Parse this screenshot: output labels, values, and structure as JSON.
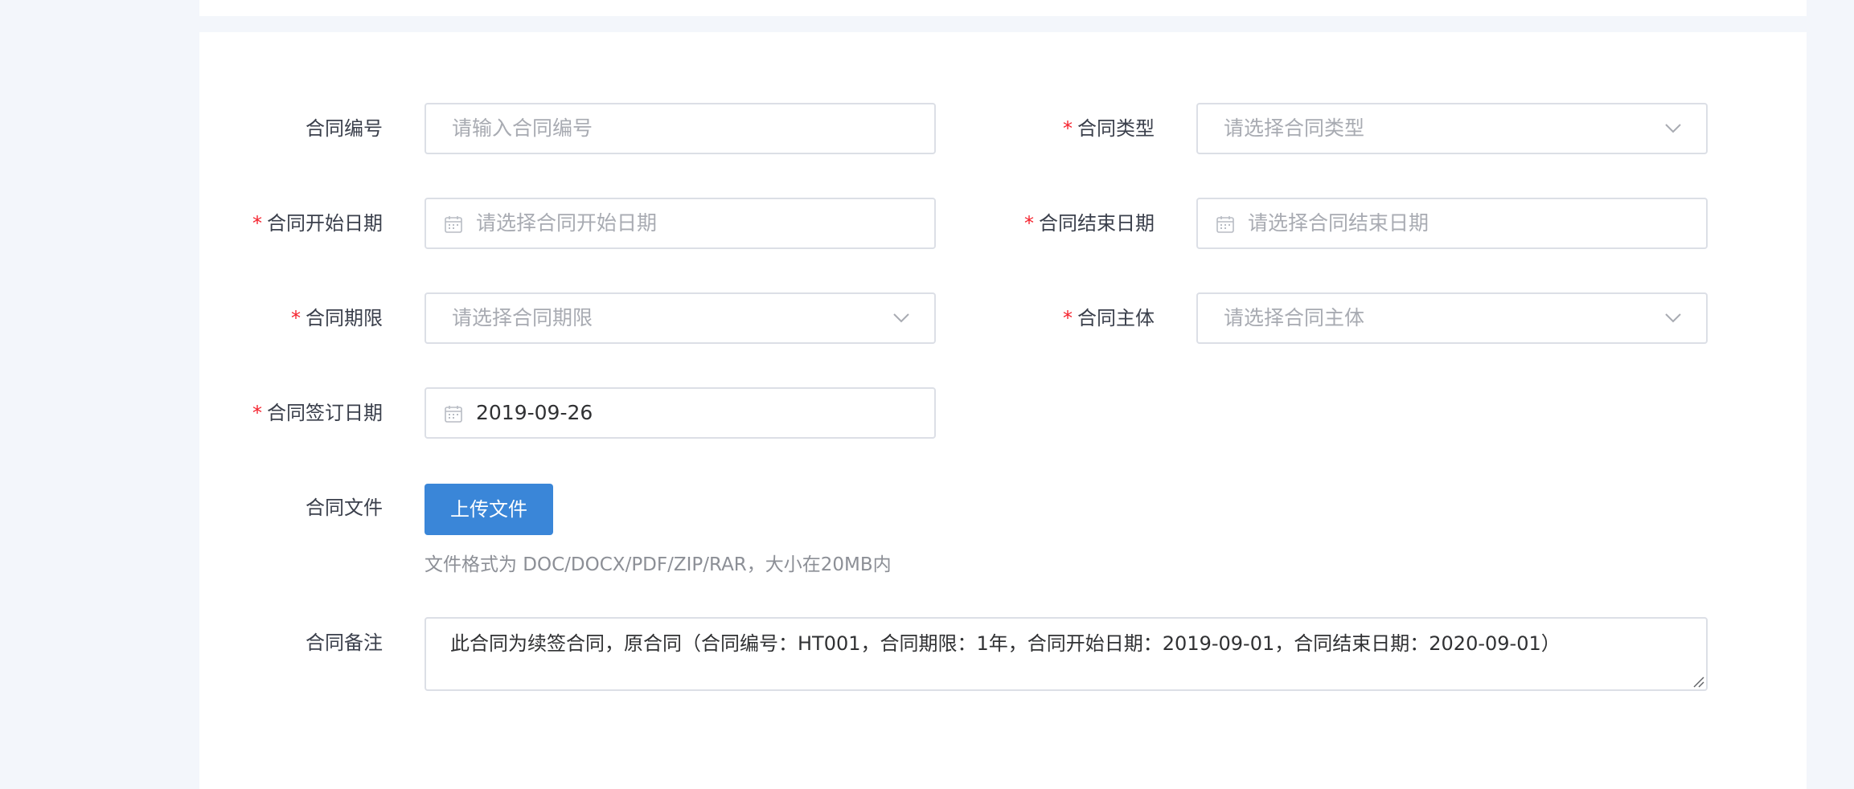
{
  "form": {
    "contract_no": {
      "label": "合同编号",
      "required": false,
      "placeholder": "请输入合同编号",
      "value": ""
    },
    "contract_type": {
      "label": "合同类型",
      "required": true,
      "placeholder": "请选择合同类型",
      "value": "",
      "icon": "chevron-down-icon"
    },
    "start_date": {
      "label": "合同开始日期",
      "required": true,
      "placeholder": "请选择合同开始日期",
      "value": "",
      "icon": "calendar-icon"
    },
    "end_date": {
      "label": "合同结束日期",
      "required": true,
      "placeholder": "请选择合同结束日期",
      "value": "",
      "icon": "calendar-icon"
    },
    "term": {
      "label": "合同期限",
      "required": true,
      "placeholder": "请选择合同期限",
      "value": "",
      "icon": "chevron-down-icon"
    },
    "subject": {
      "label": "合同主体",
      "required": true,
      "placeholder": "请选择合同主体",
      "value": "",
      "icon": "chevron-down-icon"
    },
    "sign_date": {
      "label": "合同签订日期",
      "required": true,
      "value": "2019-09-26",
      "icon": "calendar-icon"
    },
    "file": {
      "label": "合同文件",
      "button_label": "上传文件",
      "hint": "文件格式为 DOC/DOCX/PDF/ZIP/RAR，大小在20MB内"
    },
    "remark": {
      "label": "合同备注",
      "value": "此合同为续签合同，原合同（合同编号：HT001，合同期限：1年，合同开始日期：2019-09-01，合同结束日期：2020-09-01）"
    },
    "required_mark": "*"
  },
  "colors": {
    "background": "#f3f6fb",
    "card": "#ffffff",
    "border": "#dcdfe6",
    "placeholder": "#a8abb2",
    "required": "#f5222d",
    "primary": "#3a86d8"
  }
}
